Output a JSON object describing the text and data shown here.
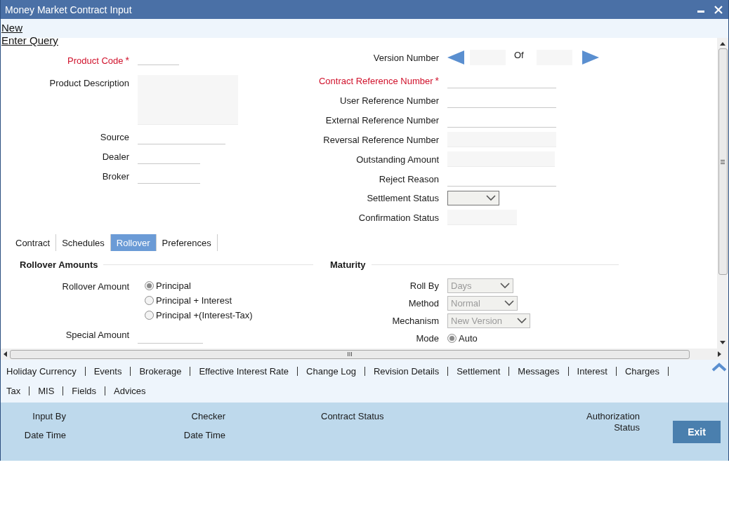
{
  "window": {
    "title": "Money Market Contract Input"
  },
  "actions": [
    {
      "label": "New"
    },
    {
      "label": "Enter Query"
    }
  ],
  "required_marker": "*",
  "main_left": [
    {
      "label": "Product Code",
      "required": true,
      "kind": "line"
    },
    {
      "label": "Product Description",
      "required": false,
      "kind": "area"
    },
    {
      "label": "Source",
      "required": false,
      "kind": "line"
    },
    {
      "label": "Dealer",
      "required": false,
      "kind": "line"
    },
    {
      "label": "Broker",
      "required": false,
      "kind": "line"
    }
  ],
  "version": {
    "label": "Version Number",
    "of": "Of"
  },
  "main_right": [
    {
      "label": "Contract Reference Number",
      "required": true,
      "kind": "line"
    },
    {
      "label": "User Reference Number",
      "required": false,
      "kind": "line"
    },
    {
      "label": "External Reference Number",
      "required": false,
      "kind": "line"
    },
    {
      "label": "Reversal Reference Number",
      "required": false,
      "kind": "box"
    },
    {
      "label": "Outstanding Amount",
      "required": false,
      "kind": "box"
    },
    {
      "label": "Reject Reason",
      "required": false,
      "kind": "line"
    },
    {
      "label": "Settlement Status",
      "required": false,
      "kind": "select",
      "disabled": false
    },
    {
      "label": "Confirmation Status",
      "required": false,
      "kind": "box"
    }
  ],
  "tabs": [
    {
      "label": "Contract",
      "selected": false
    },
    {
      "label": "Schedules",
      "selected": false
    },
    {
      "label": "Rollover",
      "selected": true
    },
    {
      "label": "Preferences",
      "selected": false
    }
  ],
  "rollover_amounts": {
    "title": "Rollover Amounts",
    "rows": [
      {
        "label": "Rollover Amount",
        "kind": "radio",
        "options": [
          {
            "label": "Principal",
            "selected": true
          },
          {
            "label": "Principal + Interest",
            "selected": false
          },
          {
            "label": "Principal +(Interest-Tax)",
            "selected": false
          }
        ]
      },
      {
        "label": "Special Amount",
        "kind": "line"
      }
    ]
  },
  "maturity": {
    "title": "Maturity",
    "rows": [
      {
        "label": "Roll By",
        "kind": "select",
        "value": "Days",
        "disabled": true
      },
      {
        "label": "Method",
        "kind": "select",
        "value": "Normal",
        "disabled": true
      },
      {
        "label": "Mechanism",
        "kind": "select",
        "value": "New Version",
        "disabled": true
      },
      {
        "label": "Mode",
        "kind": "radio",
        "options": [
          {
            "label": "Auto",
            "selected": true
          }
        ]
      }
    ]
  },
  "links": [
    [
      "Holiday Currency",
      "Events",
      "Brokerage",
      "Effective Interest Rate",
      "Change Log",
      "Revision Details",
      "Settlement",
      "Messages",
      "Interest",
      "Charges"
    ],
    [
      "Tax",
      "MIS",
      "Fields",
      "Advices"
    ]
  ],
  "audit": [
    {
      "lines": [
        "Input By",
        "Date Time"
      ]
    },
    {
      "lines": [
        "Checker",
        "Date Time"
      ]
    },
    {
      "lines": [
        "Contract Status"
      ]
    },
    {
      "lines": [
        "Authorization",
        "Status"
      ]
    }
  ],
  "exit_button": "Exit"
}
